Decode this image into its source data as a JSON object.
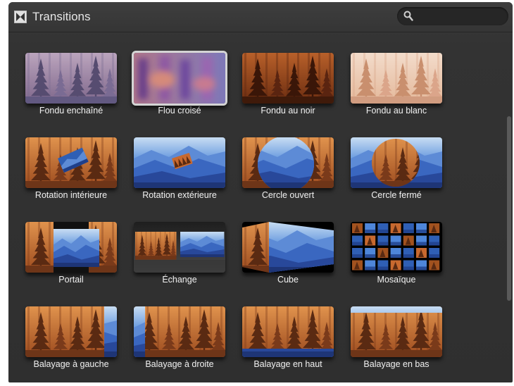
{
  "header": {
    "title": "Transitions",
    "title_icon": "transitions-icon",
    "search": {
      "icon": "search-icon",
      "placeholder": "",
      "value": ""
    }
  },
  "transitions": [
    {
      "label": "Fondu enchaîné",
      "effect": "crossfade"
    },
    {
      "label": "Flou croisé",
      "effect": "blur",
      "selected": true
    },
    {
      "label": "Fondu au noir",
      "effect": "fade-black"
    },
    {
      "label": "Fondu au blanc",
      "effect": "fade-white"
    },
    {
      "label": "Rotation intérieure",
      "effect": "spin-in"
    },
    {
      "label": "Rotation extérieure",
      "effect": "spin-out"
    },
    {
      "label": "Cercle ouvert",
      "effect": "circle-open"
    },
    {
      "label": "Cercle fermé",
      "effect": "circle-close"
    },
    {
      "label": "Portail",
      "effect": "doorway"
    },
    {
      "label": "Échange",
      "effect": "swap"
    },
    {
      "label": "Cube",
      "effect": "cube"
    },
    {
      "label": "Mosaïque",
      "effect": "mosaic"
    },
    {
      "label": "Balayage à gauche",
      "effect": "wipe-left"
    },
    {
      "label": "Balayage à droite",
      "effect": "wipe-right"
    },
    {
      "label": "Balayage en haut",
      "effect": "wipe-up"
    },
    {
      "label": "Balayage en bas",
      "effect": "wipe-down"
    }
  ],
  "colors": {
    "panel_background": "#333333",
    "forest_orange": "#c8692f",
    "mountain_blue": "#2f5fb5",
    "selection_border": "#d4d4d4"
  }
}
